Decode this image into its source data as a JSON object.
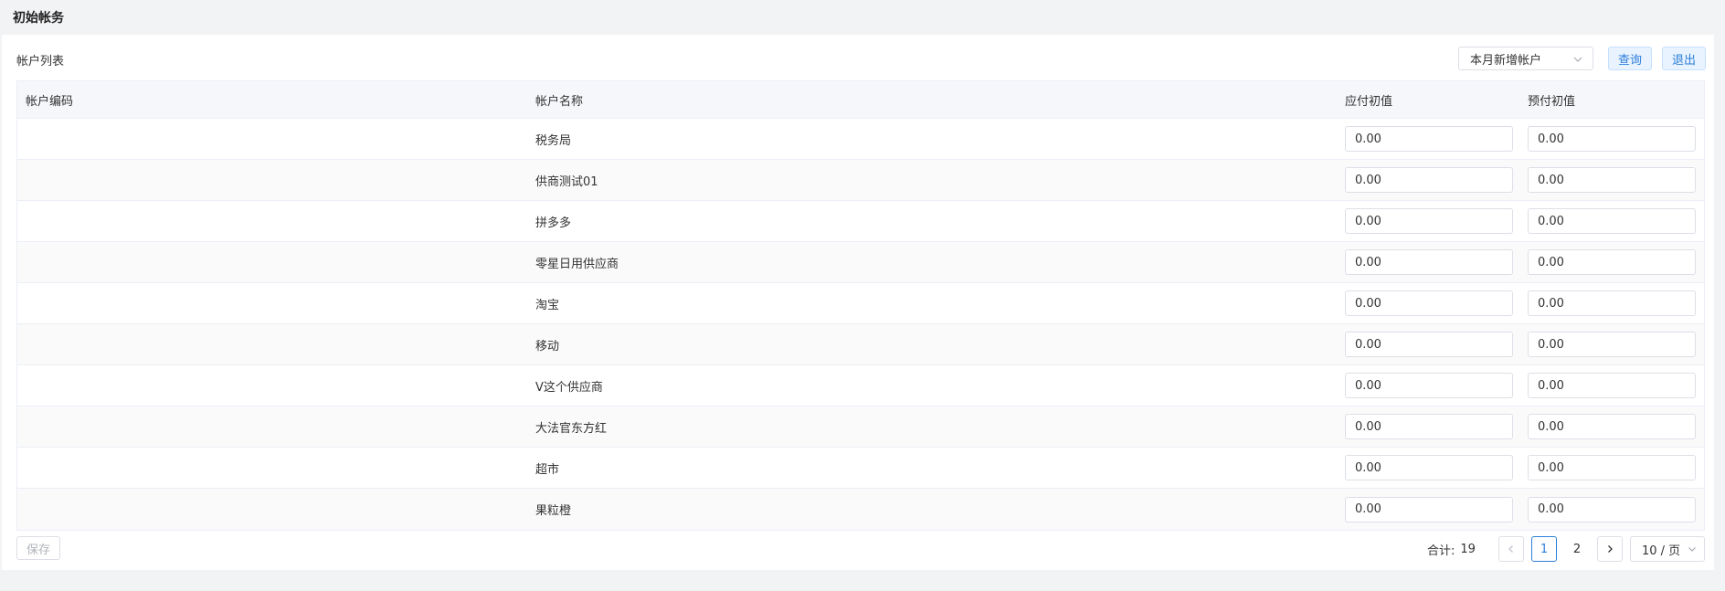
{
  "page": {
    "title": "初始帐务"
  },
  "toolbar": {
    "list_title": "帐户列表",
    "filter_value": "本月新增帐户",
    "query_label": "查询",
    "exit_label": "退出"
  },
  "table": {
    "columns": [
      "帐户编码",
      "帐户名称",
      "应付初值",
      "预付初值"
    ],
    "rows": [
      {
        "code": "",
        "name": "税务局",
        "payable": "0.00",
        "prepaid": "0.00"
      },
      {
        "code": "",
        "name": "供商测试01",
        "payable": "0.00",
        "prepaid": "0.00"
      },
      {
        "code": "",
        "name": "拼多多",
        "payable": "0.00",
        "prepaid": "0.00"
      },
      {
        "code": "",
        "name": "零星日用供应商",
        "payable": "0.00",
        "prepaid": "0.00"
      },
      {
        "code": "",
        "name": "淘宝",
        "payable": "0.00",
        "prepaid": "0.00"
      },
      {
        "code": "",
        "name": "移动",
        "payable": "0.00",
        "prepaid": "0.00"
      },
      {
        "code": "",
        "name": "V这个供应商",
        "payable": "0.00",
        "prepaid": "0.00"
      },
      {
        "code": "",
        "name": "大法官东方红",
        "payable": "0.00",
        "prepaid": "0.00"
      },
      {
        "code": "",
        "name": "超市",
        "payable": "0.00",
        "prepaid": "0.00"
      },
      {
        "code": "",
        "name": "果粒橙",
        "payable": "0.00",
        "prepaid": "0.00"
      }
    ]
  },
  "footer": {
    "save_label": "保存",
    "total_label": "合计:",
    "total_value": "19",
    "pages": [
      "1",
      "2"
    ],
    "current_page": "1",
    "page_size": "10 / 页"
  },
  "icons": {
    "prev": "chevron-left-icon",
    "next": "chevron-right-icon",
    "dropdown": "chevron-down-icon"
  },
  "colors": {
    "accent": "#2d7fd8",
    "accent_bg": "#e8f3ff",
    "page_bg": "#f2f3f5"
  }
}
